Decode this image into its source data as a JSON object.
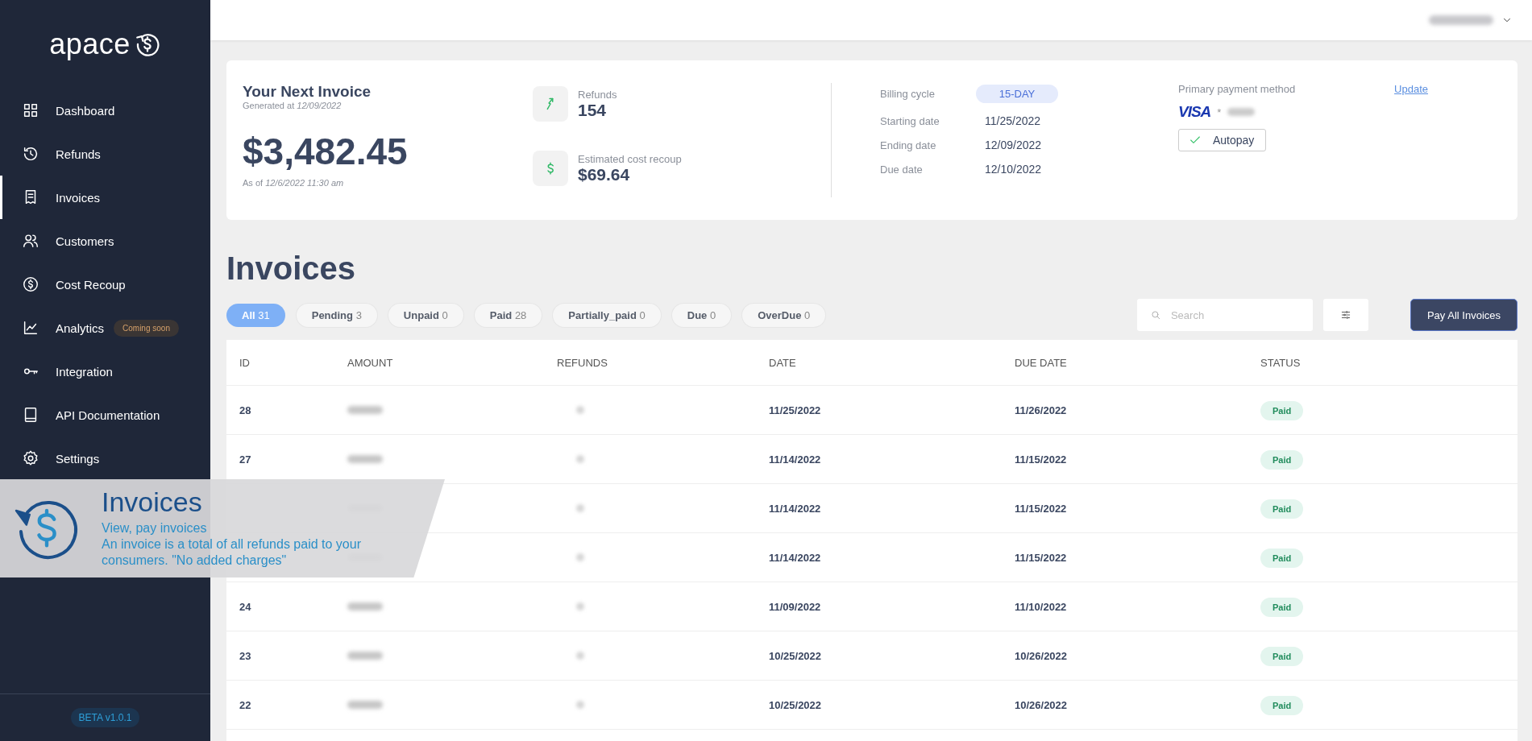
{
  "sidebar": {
    "logo": "apace",
    "items": [
      {
        "label": "Dashboard",
        "selected": false
      },
      {
        "label": "Refunds",
        "selected": false
      },
      {
        "label": "Invoices",
        "selected": true
      },
      {
        "label": "Customers",
        "selected": false
      },
      {
        "label": "Cost Recoup",
        "selected": false
      },
      {
        "label": "Analytics",
        "selected": false,
        "badge": "Coming soon"
      },
      {
        "label": "Integration",
        "selected": false
      },
      {
        "label": "API Documentation",
        "selected": false
      },
      {
        "label": "Settings",
        "selected": false
      }
    ],
    "version": "BETA v1.0.1"
  },
  "summary": {
    "title": "Your Next Invoice",
    "generated": "Generated at *12/09/2022*",
    "amount": "$3,482.45",
    "as_of": "As of *12/6/2022 11:30 am*",
    "stats": [
      {
        "kind": "trend",
        "label": "Refunds",
        "value": "154"
      },
      {
        "kind": "dollar",
        "label": "Estimated cost recoup",
        "value": "$69.64"
      }
    ],
    "billing": [
      {
        "kind": "pill",
        "label": "Billing cycle",
        "value": "15-DAY"
      },
      {
        "kind": "text",
        "label": "Starting date",
        "value": "11/25/2022"
      },
      {
        "kind": "text",
        "label": "Ending date",
        "value": "12/09/2022"
      },
      {
        "kind": "text",
        "label": "Due date",
        "value": "12/10/2022"
      }
    ],
    "payment": {
      "label": "Primary payment method",
      "update": "Update",
      "brand": "VISA",
      "card_mask": "*",
      "autopay": {
        "label": "Autopay",
        "checked": true
      }
    }
  },
  "invoices": {
    "title": "Invoices",
    "filters": [
      {
        "label": "All",
        "count": "31",
        "selected": true
      },
      {
        "label": "Pending",
        "count": "3",
        "selected": false
      },
      {
        "label": "Unpaid",
        "count": "0",
        "selected": false
      },
      {
        "label": "Paid",
        "count": "28",
        "selected": false
      },
      {
        "label": "Partially_paid",
        "count": "0",
        "selected": false
      },
      {
        "label": "Due",
        "count": "0",
        "selected": false
      },
      {
        "label": "OverDue",
        "count": "0",
        "selected": false
      }
    ],
    "search": {
      "placeholder": "Search"
    },
    "pay_button": "Pay All Invoices",
    "table": {
      "columns": [
        "ID",
        "AMOUNT",
        "REFUNDS",
        "DATE",
        "DUE DATE",
        "STATUS"
      ],
      "rows": [
        {
          "id": "28",
          "date": "11/25/2022",
          "due_date": "11/26/2022",
          "status": "Paid"
        },
        {
          "id": "27",
          "date": "11/14/2022",
          "due_date": "11/15/2022",
          "status": "Paid"
        },
        {
          "date": "11/14/2022",
          "due_date": "11/15/2022",
          "status": "Paid"
        },
        {
          "date": "11/14/2022",
          "due_date": "11/15/2022",
          "status": "Paid"
        },
        {
          "id": "24",
          "date": "11/09/2022",
          "due_date": "11/10/2022",
          "status": "Paid"
        },
        {
          "id": "23",
          "date": "10/25/2022",
          "due_date": "10/26/2022",
          "status": "Paid"
        },
        {
          "id": "22",
          "date": "10/25/2022",
          "due_date": "10/26/2022",
          "status": "Paid"
        }
      ]
    }
  },
  "banner": {
    "title": "Invoices",
    "subtitle": "View, pay invoices",
    "description": "An invoice is a total of all refunds paid to your consumers. \"No added charges\""
  }
}
